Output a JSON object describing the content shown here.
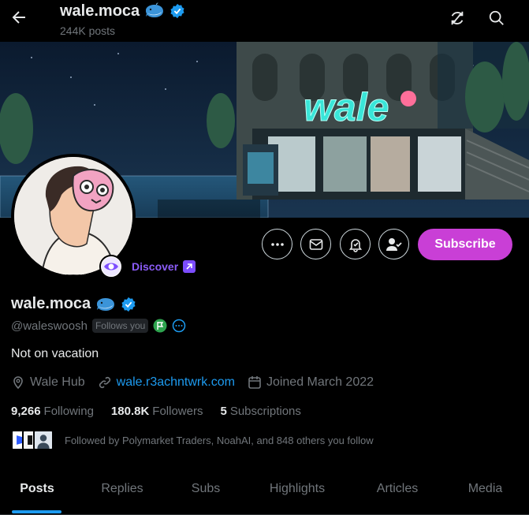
{
  "header": {
    "title": "wale.moca",
    "posts_count": "244K posts"
  },
  "banner": {
    "sign_text": "wale"
  },
  "discover": {
    "label": "Discover"
  },
  "actions": {
    "subscribe_label": "Subscribe"
  },
  "profile": {
    "name": "wale.moca",
    "handle": "@waleswoosh",
    "follows_you": "Follows you",
    "bio": "Not on vacation",
    "location": "Wale Hub",
    "website": "wale.r3achntwrk.com",
    "joined": "Joined March 2022"
  },
  "stats": {
    "following_count": "9,266",
    "following_label": "Following",
    "followers_count": "180.8K",
    "followers_label": "Followers",
    "subscriptions_count": "5",
    "subscriptions_label": "Subscriptions"
  },
  "followed_by": {
    "text": "Followed by Polymarket Traders, NoahAI, and 848 others you follow"
  },
  "tabs": [
    {
      "label": "Posts"
    },
    {
      "label": "Replies"
    },
    {
      "label": "Subs"
    },
    {
      "label": "Highlights"
    },
    {
      "label": "Articles"
    },
    {
      "label": "Media"
    }
  ],
  "colors": {
    "accent_blue": "#1d9bf0",
    "subscribe_purple": "#c93fd6",
    "verified_blue": "#1d9bf0",
    "discover_purple": "#8b5cf6"
  },
  "icons": {
    "back": "arrow-left-icon",
    "sync": "sync-icon",
    "search": "search-icon",
    "more": "more-icon",
    "message": "mail-icon",
    "notify": "bell-icon",
    "follow": "user-check-icon",
    "location": "location-icon",
    "link": "link-icon",
    "calendar": "calendar-icon"
  }
}
